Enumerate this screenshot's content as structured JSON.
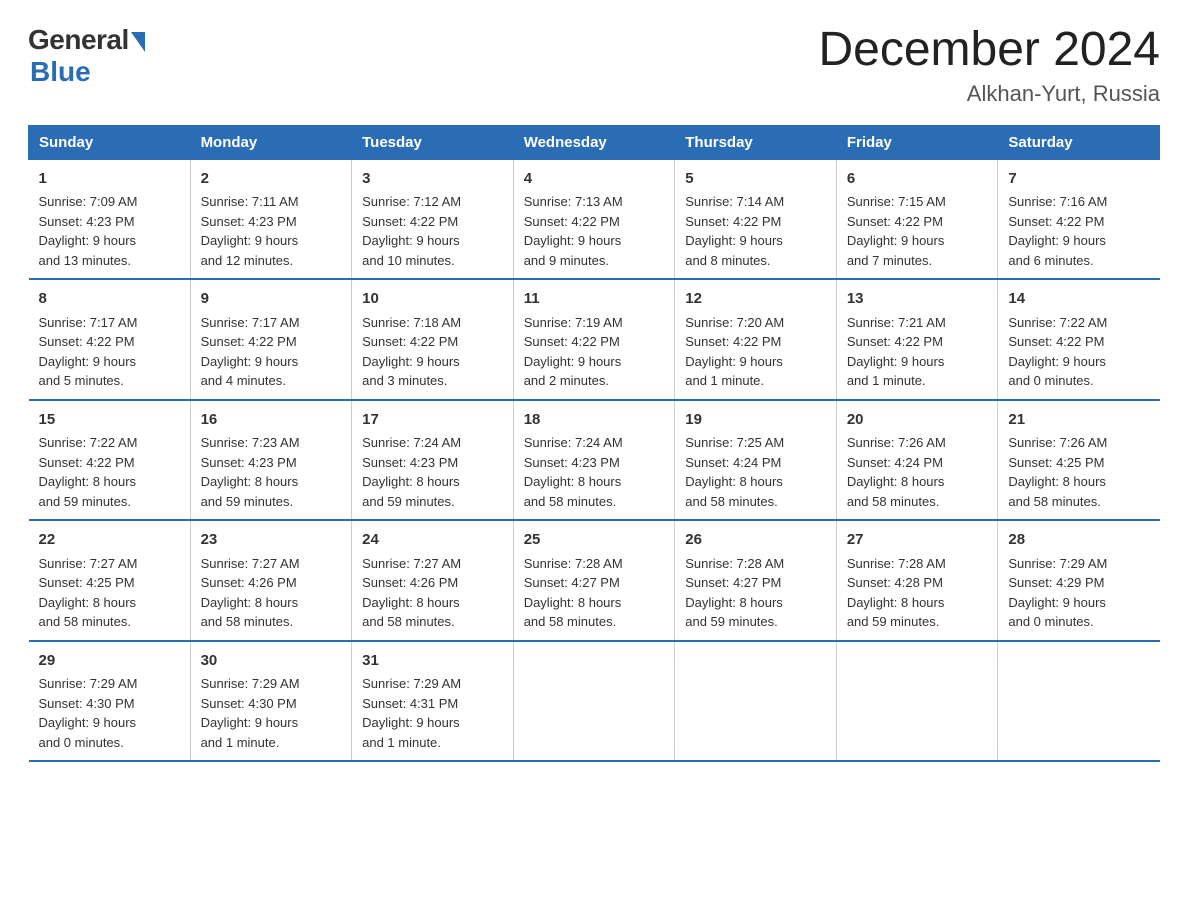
{
  "logo": {
    "general": "General",
    "blue": "Blue"
  },
  "title": "December 2024",
  "location": "Alkhan-Yurt, Russia",
  "days_of_week": [
    "Sunday",
    "Monday",
    "Tuesday",
    "Wednesday",
    "Thursday",
    "Friday",
    "Saturday"
  ],
  "weeks": [
    [
      {
        "day": "1",
        "sunrise": "7:09 AM",
        "sunset": "4:23 PM",
        "daylight": "9 hours and 13 minutes."
      },
      {
        "day": "2",
        "sunrise": "7:11 AM",
        "sunset": "4:23 PM",
        "daylight": "9 hours and 12 minutes."
      },
      {
        "day": "3",
        "sunrise": "7:12 AM",
        "sunset": "4:22 PM",
        "daylight": "9 hours and 10 minutes."
      },
      {
        "day": "4",
        "sunrise": "7:13 AM",
        "sunset": "4:22 PM",
        "daylight": "9 hours and 9 minutes."
      },
      {
        "day": "5",
        "sunrise": "7:14 AM",
        "sunset": "4:22 PM",
        "daylight": "9 hours and 8 minutes."
      },
      {
        "day": "6",
        "sunrise": "7:15 AM",
        "sunset": "4:22 PM",
        "daylight": "9 hours and 7 minutes."
      },
      {
        "day": "7",
        "sunrise": "7:16 AM",
        "sunset": "4:22 PM",
        "daylight": "9 hours and 6 minutes."
      }
    ],
    [
      {
        "day": "8",
        "sunrise": "7:17 AM",
        "sunset": "4:22 PM",
        "daylight": "9 hours and 5 minutes."
      },
      {
        "day": "9",
        "sunrise": "7:17 AM",
        "sunset": "4:22 PM",
        "daylight": "9 hours and 4 minutes."
      },
      {
        "day": "10",
        "sunrise": "7:18 AM",
        "sunset": "4:22 PM",
        "daylight": "9 hours and 3 minutes."
      },
      {
        "day": "11",
        "sunrise": "7:19 AM",
        "sunset": "4:22 PM",
        "daylight": "9 hours and 2 minutes."
      },
      {
        "day": "12",
        "sunrise": "7:20 AM",
        "sunset": "4:22 PM",
        "daylight": "9 hours and 1 minute."
      },
      {
        "day": "13",
        "sunrise": "7:21 AM",
        "sunset": "4:22 PM",
        "daylight": "9 hours and 1 minute."
      },
      {
        "day": "14",
        "sunrise": "7:22 AM",
        "sunset": "4:22 PM",
        "daylight": "9 hours and 0 minutes."
      }
    ],
    [
      {
        "day": "15",
        "sunrise": "7:22 AM",
        "sunset": "4:22 PM",
        "daylight": "8 hours and 59 minutes."
      },
      {
        "day": "16",
        "sunrise": "7:23 AM",
        "sunset": "4:23 PM",
        "daylight": "8 hours and 59 minutes."
      },
      {
        "day": "17",
        "sunrise": "7:24 AM",
        "sunset": "4:23 PM",
        "daylight": "8 hours and 59 minutes."
      },
      {
        "day": "18",
        "sunrise": "7:24 AM",
        "sunset": "4:23 PM",
        "daylight": "8 hours and 58 minutes."
      },
      {
        "day": "19",
        "sunrise": "7:25 AM",
        "sunset": "4:24 PM",
        "daylight": "8 hours and 58 minutes."
      },
      {
        "day": "20",
        "sunrise": "7:26 AM",
        "sunset": "4:24 PM",
        "daylight": "8 hours and 58 minutes."
      },
      {
        "day": "21",
        "sunrise": "7:26 AM",
        "sunset": "4:25 PM",
        "daylight": "8 hours and 58 minutes."
      }
    ],
    [
      {
        "day": "22",
        "sunrise": "7:27 AM",
        "sunset": "4:25 PM",
        "daylight": "8 hours and 58 minutes."
      },
      {
        "day": "23",
        "sunrise": "7:27 AM",
        "sunset": "4:26 PM",
        "daylight": "8 hours and 58 minutes."
      },
      {
        "day": "24",
        "sunrise": "7:27 AM",
        "sunset": "4:26 PM",
        "daylight": "8 hours and 58 minutes."
      },
      {
        "day": "25",
        "sunrise": "7:28 AM",
        "sunset": "4:27 PM",
        "daylight": "8 hours and 58 minutes."
      },
      {
        "day": "26",
        "sunrise": "7:28 AM",
        "sunset": "4:27 PM",
        "daylight": "8 hours and 59 minutes."
      },
      {
        "day": "27",
        "sunrise": "7:28 AM",
        "sunset": "4:28 PM",
        "daylight": "8 hours and 59 minutes."
      },
      {
        "day": "28",
        "sunrise": "7:29 AM",
        "sunset": "4:29 PM",
        "daylight": "9 hours and 0 minutes."
      }
    ],
    [
      {
        "day": "29",
        "sunrise": "7:29 AM",
        "sunset": "4:30 PM",
        "daylight": "9 hours and 0 minutes."
      },
      {
        "day": "30",
        "sunrise": "7:29 AM",
        "sunset": "4:30 PM",
        "daylight": "9 hours and 1 minute."
      },
      {
        "day": "31",
        "sunrise": "7:29 AM",
        "sunset": "4:31 PM",
        "daylight": "9 hours and 1 minute."
      },
      null,
      null,
      null,
      null
    ]
  ],
  "labels": {
    "sunrise": "Sunrise:",
    "sunset": "Sunset:",
    "daylight": "Daylight:"
  }
}
